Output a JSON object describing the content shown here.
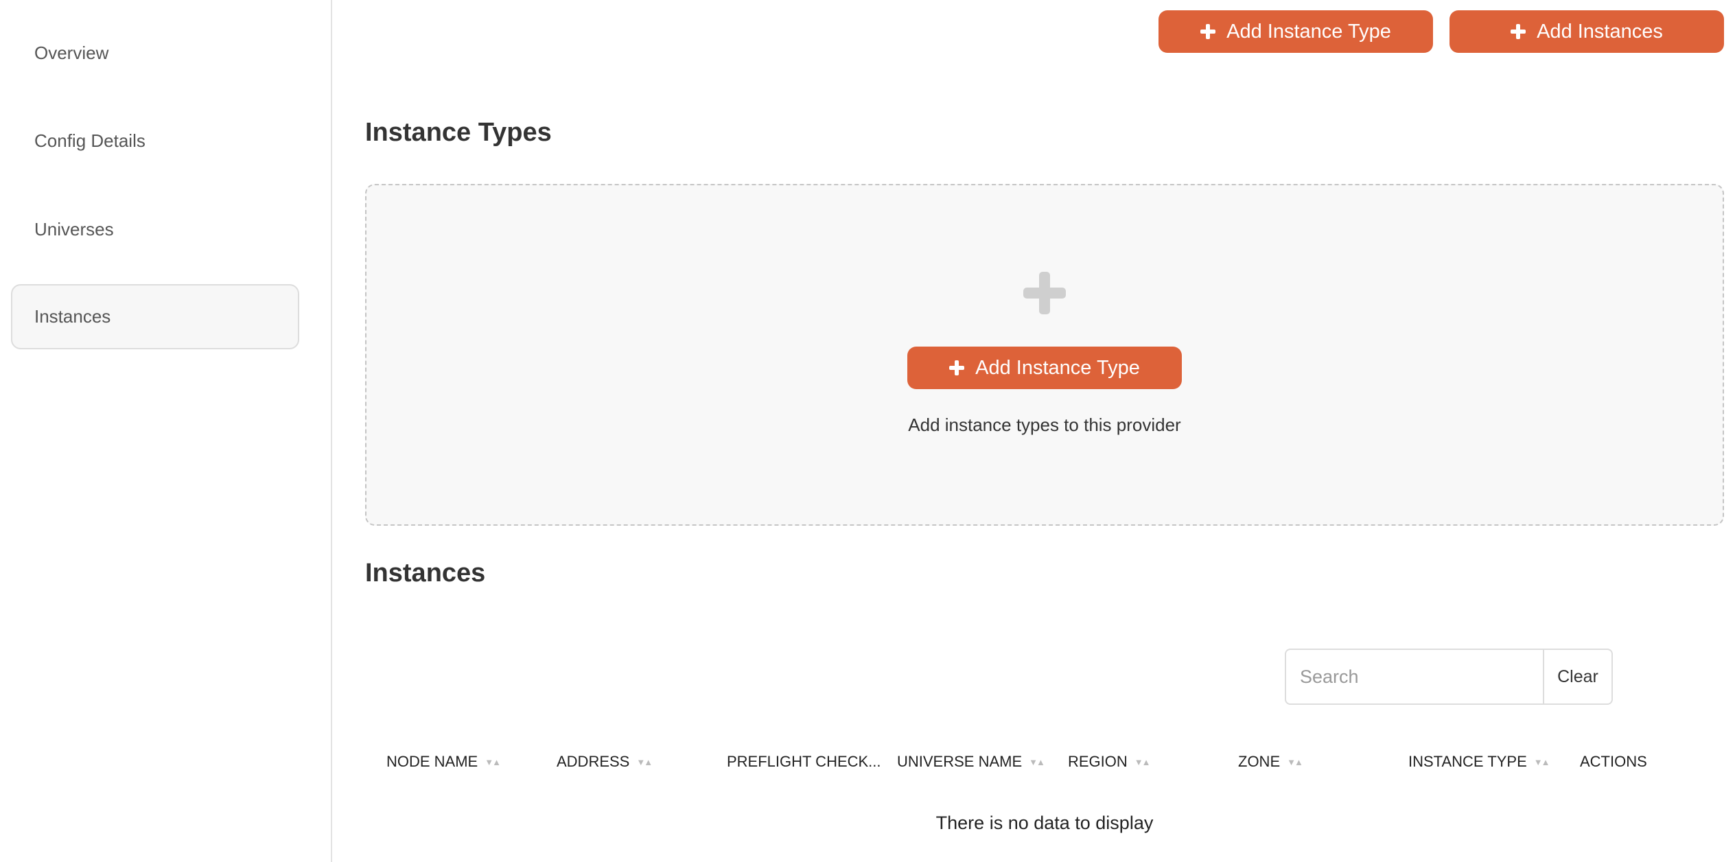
{
  "sidebar": {
    "items": [
      {
        "label": "Overview",
        "active": false
      },
      {
        "label": "Config Details",
        "active": false
      },
      {
        "label": "Universes",
        "active": false
      },
      {
        "label": "Instances",
        "active": true
      }
    ]
  },
  "header": {
    "add_instance_type": "Add Instance Type",
    "add_instances": "Add Instances"
  },
  "instance_types": {
    "title": "Instance Types",
    "add_button": "Add Instance Type",
    "hint": "Add instance types to this provider"
  },
  "instances": {
    "title": "Instances",
    "search_placeholder": "Search",
    "clear_label": "Clear",
    "columns": [
      {
        "label": "NODE NAME",
        "sortable": true
      },
      {
        "label": "ADDRESS",
        "sortable": true
      },
      {
        "label": "PREFLIGHT CHECK...",
        "sortable": false
      },
      {
        "label": "UNIVERSE NAME",
        "sortable": true
      },
      {
        "label": "REGION",
        "sortable": true
      },
      {
        "label": "ZONE",
        "sortable": true
      },
      {
        "label": "INSTANCE TYPE",
        "sortable": true
      },
      {
        "label": "ACTIONS",
        "sortable": false
      }
    ],
    "empty_text": "There is no data to display"
  },
  "colors": {
    "accent": "#dd6239"
  }
}
